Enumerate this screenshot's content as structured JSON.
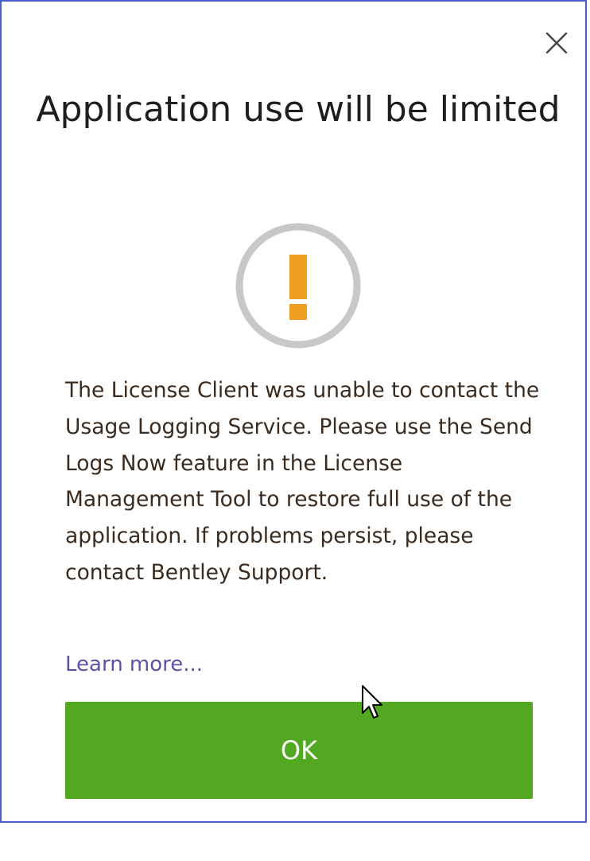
{
  "dialog": {
    "title": "Application use will be limited",
    "message": "The License Client was unable to contact the Usage Logging Service. Please use the Send Logs Now feature in the License Management Tool to restore full use of the application.  If problems persist, please contact Bentley Support.",
    "learn_more_label": "Learn more...",
    "ok_label": "OK",
    "icons": {
      "close": "close-icon",
      "warning": "warning-exclamation-icon",
      "cursor": "mouse-pointer-icon"
    },
    "colors": {
      "border": "#4a5fcf",
      "accent_button": "#52a921",
      "warning": "#f0a020",
      "warning_ring": "#c8c8c8",
      "link": "#5b53a8",
      "text": "#3b2a1e"
    }
  }
}
